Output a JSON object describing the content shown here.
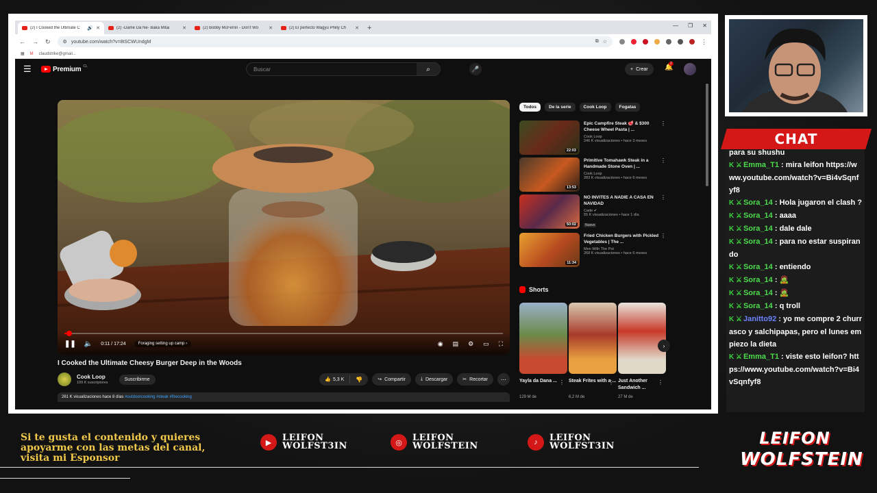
{
  "browser": {
    "tabs": [
      {
        "label": "(2) I Cooked the Ultimate C",
        "active": true
      },
      {
        "label": "(2) -Dame Da Ne- Baka Mitai",
        "active": false
      },
      {
        "label": "(2) Bobby McFerrin - Don't Wo",
        "active": false
      },
      {
        "label": "(2) El perfecto Wagyu Philly Ch",
        "active": false
      }
    ],
    "url": "youtube.com/watch?v=8tSCWUndgM",
    "bookmark": "claudstrike@gmail..."
  },
  "youtube": {
    "logo_text": "Premium",
    "logo_region": "CL",
    "search_placeholder": "Buscar",
    "create_label": "Crear",
    "notif_count": "2",
    "player": {
      "time": "0:11 / 17:24",
      "chapter": "Foraging setting up camp",
      "progress": 0.011
    },
    "video": {
      "title": "I Cooked the Ultimate Cheesy Burger Deep in the Woods",
      "channel": "Cook Loop",
      "subscribers": "109 K suscriptores",
      "subscribe_label": "Suscribirme",
      "likes": "5,3 K",
      "share_label": "Compartir",
      "download_label": "Descargar",
      "clip_label": "Recortar",
      "desc_stats": "261 K visualizaciones  hace 8 días",
      "desc_tags": "#outdoorcooking #steak #firecooking"
    },
    "chips": [
      "Todos",
      "De la serie",
      "Cook Loop",
      "Fogatas"
    ],
    "recommendations": [
      {
        "title": "Epic Campfire Steak 🥩 & $300 Cheese Wheel Pasta | ...",
        "channel": "Cook Loop",
        "stats": "246 K visualizaciones • hace 3 meses",
        "duration": "22:03",
        "badge": ""
      },
      {
        "title": "Primitive Tomahawk Steak in a Handmade Stone Oven | ...",
        "channel": "Cook Loop",
        "stats": "283 K visualizaciones • hace 6 meses",
        "duration": "13:53",
        "badge": ""
      },
      {
        "title": "NO INVITES A NADIE A CASA EN NAVIDAD",
        "channel": "Cade ✔",
        "stats": "55 K visualizaciones • hace 1 día",
        "duration": "50:02",
        "badge": "Nuevo"
      },
      {
        "title": "Fried Chicken Burgers with Pickled Vegetables | The ...",
        "channel": "Men With The Pot",
        "stats": "268 K visualizaciones • hace 6 meses",
        "duration": "11:34",
        "badge": ""
      }
    ],
    "shorts_title": "Shorts",
    "shorts": [
      {
        "title": "Yayla da Dana ...",
        "views": "129 M de"
      },
      {
        "title": "Steak Frites with a ...",
        "views": "6,2 M de"
      },
      {
        "title": "Just Another Sandwich ...",
        "views": "27 M de"
      }
    ]
  },
  "chat": {
    "title": "CHAT",
    "messages": [
      {
        "user": "",
        "text": "para su shushu"
      },
      {
        "user": "Emma_T1",
        "text": "mira leifon https://www.youtube.com/watch?v=Bi4vSqnfyf8"
      },
      {
        "user": "Sora_14",
        "text": "Hola jugaron el clash ?"
      },
      {
        "user": "Sora_14",
        "text": "aaaa"
      },
      {
        "user": "Sora_14",
        "text": "dale dale"
      },
      {
        "user": "Sora_14",
        "text": "para no estar suspirando"
      },
      {
        "user": "Sora_14",
        "text": "entiendo"
      },
      {
        "user": "Sora_14",
        "text": "🧟"
      },
      {
        "user": "Sora_14",
        "text": "🧟"
      },
      {
        "user": "Sora_14",
        "text": "q troll"
      },
      {
        "user": "Janitto92",
        "text": "yo me compre 2 churrasco y salchipapas, pero el lunes empiezo la dieta",
        "blue": true
      },
      {
        "user": "Emma_T1",
        "text": "viste esto leifon? https://www.youtube.com/watch?v=Bi4vSqnfyf8"
      }
    ]
  },
  "overlay": {
    "sponsor_text": "Si te gusta el contenido y quieres apoyarme con las metas del canal, visita mi Esponsor",
    "socials": [
      {
        "icon": "youtube-icon",
        "line1": "LEIFON",
        "line2": "WOLFST3IN"
      },
      {
        "icon": "instagram-icon",
        "line1": "LEIFON",
        "line2": "WOLFSTEIN"
      },
      {
        "icon": "tiktok-icon",
        "line1": "LEIFON",
        "line2": "WOLFST3IN"
      }
    ],
    "brand_line1": "LEIFON",
    "brand_line2": "WOLFSTEIN"
  }
}
